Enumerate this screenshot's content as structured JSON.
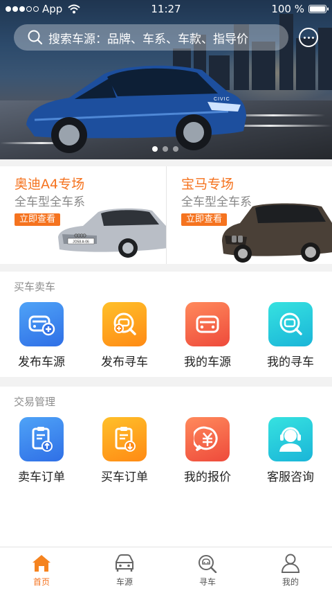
{
  "status_bar": {
    "carrier": "App",
    "time": "11:27",
    "battery": "100 %",
    "signal_filled": 3,
    "signal_total": 5
  },
  "search": {
    "placeholder": "搜索车源：品牌、车系、车款、指导价"
  },
  "banner": {
    "slides": 3,
    "active_slide": 1,
    "badge": "CIVIC"
  },
  "promos": [
    {
      "title": "奥迪A4专场",
      "subtitle": "全车型全车系",
      "button": "立即查看",
      "plate": "JO58 A·06"
    },
    {
      "title": "宝马专场",
      "subtitle": "全车型全车系",
      "button": "立即查看"
    }
  ],
  "buy_sell": {
    "heading": "买车卖车",
    "items": [
      {
        "label": "发布车源",
        "icon": "car-add-icon",
        "color": "#2f6fe6"
      },
      {
        "label": "发布寻车",
        "icon": "car-search-add-icon",
        "color": "#ff8a14"
      },
      {
        "label": "我的车源",
        "icon": "car-icon",
        "color": "#ee4a3b"
      },
      {
        "label": "我的寻车",
        "icon": "car-search-icon",
        "color": "#1ab5d8"
      }
    ]
  },
  "trade": {
    "heading": "交易管理",
    "items": [
      {
        "label": "卖车订单",
        "icon": "order-upload-icon",
        "color": "#2f6fe6"
      },
      {
        "label": "买车订单",
        "icon": "order-download-icon",
        "color": "#ff8a14"
      },
      {
        "label": "我的报价",
        "icon": "yuan-chat-icon",
        "color": "#ee4a3b"
      },
      {
        "label": "客服咨询",
        "icon": "headset-agent-icon",
        "color": "#1ab5d8"
      }
    ]
  },
  "tabs": [
    {
      "label": "首页",
      "icon": "home-icon",
      "active": true
    },
    {
      "label": "车源",
      "icon": "car-source-icon",
      "active": false
    },
    {
      "label": "寻车",
      "icon": "find-car-icon",
      "active": false
    },
    {
      "label": "我的",
      "icon": "user-icon",
      "active": false
    }
  ],
  "colors": {
    "accent": "#f5731f",
    "background": "#f2f2f2"
  }
}
